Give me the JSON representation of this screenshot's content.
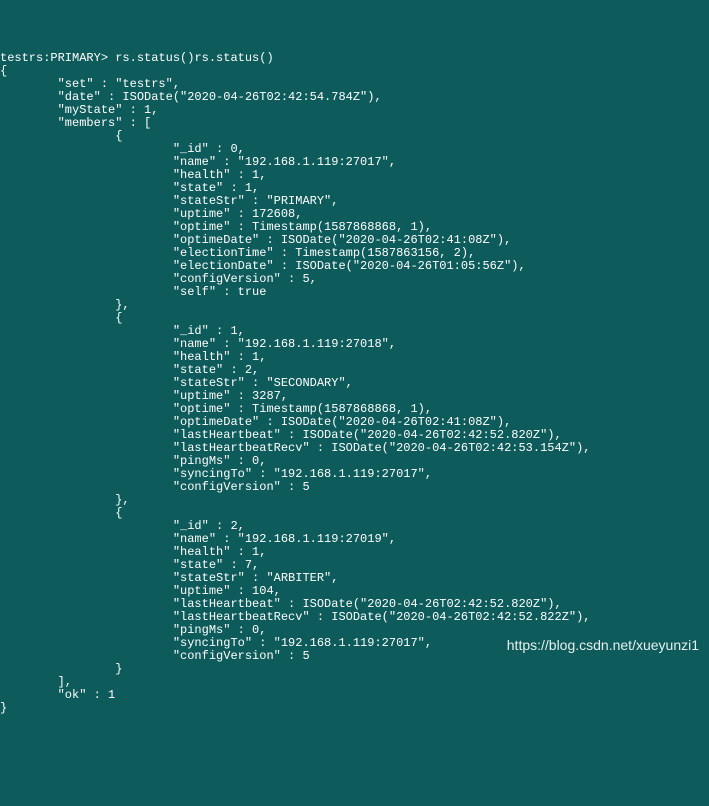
{
  "prompt": "testrs:PRIMARY>",
  "command": "rs.status()rs.status()",
  "open_brace": "{",
  "set_line": "        \"set\" : \"testrs\",",
  "date_line": "        \"date\" : ISODate(\"2020-04-26T02:42:54.784Z\"),",
  "mystate_line": "        \"myState\" : 1,",
  "members_open": "        \"members\" : [",
  "m0_open": "                {",
  "m0_id": "                        \"_id\" : 0,",
  "m0_name": "                        \"name\" : \"192.168.1.119:27017\",",
  "m0_health": "                        \"health\" : 1,",
  "m0_state": "                        \"state\" : 1,",
  "m0_stateStr": "                        \"stateStr\" : \"PRIMARY\",",
  "m0_uptime": "                        \"uptime\" : 172608,",
  "m0_optime": "                        \"optime\" : Timestamp(1587868868, 1),",
  "m0_optimeDate": "                        \"optimeDate\" : ISODate(\"2020-04-26T02:41:08Z\"),",
  "m0_electionTime": "                        \"electionTime\" : Timestamp(1587863156, 2),",
  "m0_electionDate": "                        \"electionDate\" : ISODate(\"2020-04-26T01:05:56Z\"),",
  "m0_configVersion": "                        \"configVersion\" : 5,",
  "m0_self": "                        \"self\" : true",
  "m0_close": "                },",
  "m1_open": "                {",
  "m1_id": "                        \"_id\" : 1,",
  "m1_name": "                        \"name\" : \"192.168.1.119:27018\",",
  "m1_health": "                        \"health\" : 1,",
  "m1_state": "                        \"state\" : 2,",
  "m1_stateStr": "                        \"stateStr\" : \"SECONDARY\",",
  "m1_uptime": "                        \"uptime\" : 3287,",
  "m1_optime": "                        \"optime\" : Timestamp(1587868868, 1),",
  "m1_optimeDate": "                        \"optimeDate\" : ISODate(\"2020-04-26T02:41:08Z\"),",
  "m1_lastHeartbeat": "                        \"lastHeartbeat\" : ISODate(\"2020-04-26T02:42:52.820Z\"),",
  "m1_lastHeartbeatRecv": "                        \"lastHeartbeatRecv\" : ISODate(\"2020-04-26T02:42:53.154Z\"),",
  "m1_pingMs": "                        \"pingMs\" : 0,",
  "m1_syncingTo": "                        \"syncingTo\" : \"192.168.1.119:27017\",",
  "m1_configVersion": "                        \"configVersion\" : 5",
  "m1_close": "                },",
  "m2_open": "                {",
  "m2_id": "                        \"_id\" : 2,",
  "m2_name": "                        \"name\" : \"192.168.1.119:27019\",",
  "m2_health": "                        \"health\" : 1,",
  "m2_state": "                        \"state\" : 7,",
  "m2_stateStr": "                        \"stateStr\" : \"ARBITER\",",
  "m2_uptime": "                        \"uptime\" : 104,",
  "m2_lastHeartbeat": "                        \"lastHeartbeat\" : ISODate(\"2020-04-26T02:42:52.820Z\"),",
  "m2_lastHeartbeatRecv": "                        \"lastHeartbeatRecv\" : ISODate(\"2020-04-26T02:42:52.822Z\"),",
  "m2_pingMs": "                        \"pingMs\" : 0,",
  "m2_syncingTo": "                        \"syncingTo\" : \"192.168.1.119:27017\",",
  "m2_configVersion": "                        \"configVersion\" : 5",
  "m2_close": "                }",
  "members_close": "        ],",
  "ok_line": "        \"ok\" : 1",
  "close_brace": "}",
  "watermark": "https://blog.csdn.net/xueyunzi1"
}
